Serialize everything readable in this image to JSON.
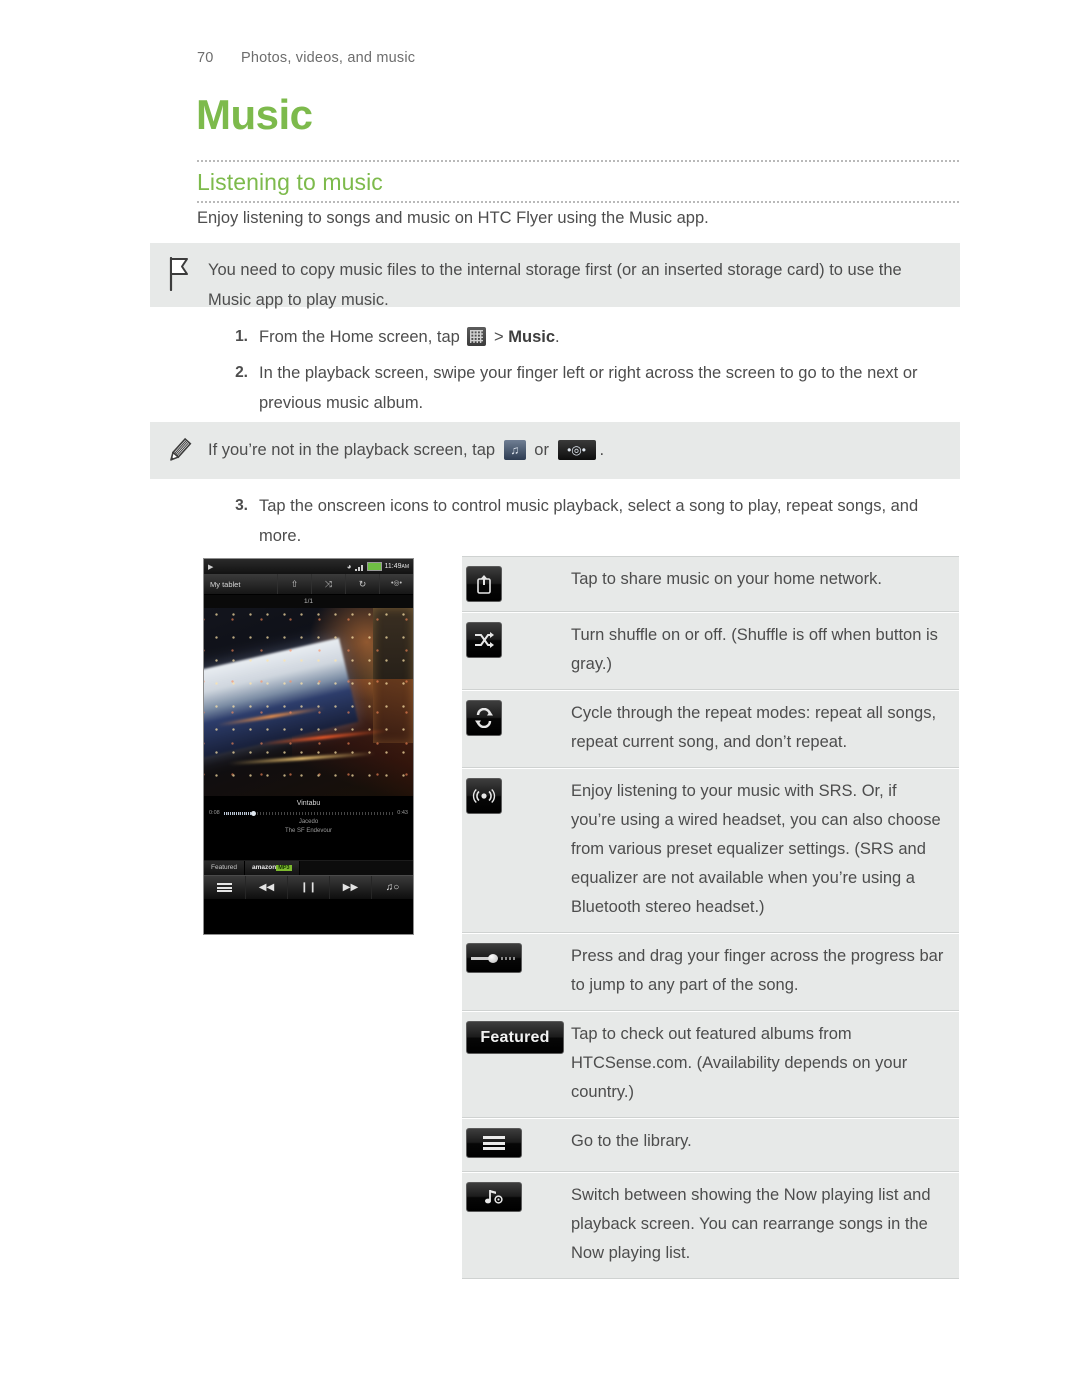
{
  "header": {
    "page_number": "70",
    "running_title": "Photos, videos, and music"
  },
  "chapter": {
    "title": "Music"
  },
  "section": {
    "heading": "Listening to music",
    "intro": "Enjoy listening to songs and music on HTC Flyer using the Music app."
  },
  "callouts": [
    {
      "icon": "flag-icon",
      "text": "You need to copy music files to the internal storage first (or an inserted storage card) to use the Music app to play music."
    },
    {
      "icon": "pencil-icon",
      "text_before": "If you’re not in the playback screen, tap",
      "text_middle": "or",
      "text_after": "."
    }
  ],
  "steps": [
    {
      "number": "1.",
      "text_before": "From the Home screen, tap",
      "text_after": ">",
      "bold_target": "Music",
      "trailing": "."
    },
    {
      "number": "2.",
      "text": "In the playback screen, swipe your finger left or right across the screen to go to the next or previous music album."
    },
    {
      "number": "3.",
      "text": "Tap the onscreen icons to control music playback, select a song to play, repeat songs, and more."
    }
  ],
  "device": {
    "status_clock": "11:49",
    "status_ampm": "AM",
    "toolbar_title": "My tablet",
    "toolbar_buttons": [
      "share-icon",
      "shuffle-icon",
      "repeat-icon",
      "srs-icon"
    ],
    "pager": "1/1",
    "now_title": "Vintabu",
    "elapsed": "0:08",
    "duration": "0:43",
    "artist": "Jacedo",
    "album": "The SF Endevour",
    "tab_featured": "Featured",
    "tab_amazon": "amazon",
    "tab_amazon_badge": "MP3",
    "controls": [
      "library-icon",
      "rewind-icon",
      "pause-icon",
      "forward-icon",
      "now-playing-icon"
    ]
  },
  "ref_table": {
    "rows": [
      {
        "icon": "share-icon",
        "description": "Tap to share music on your home network."
      },
      {
        "icon": "shuffle-icon",
        "description": "Turn shuffle on or off. (Shuffle is off when button is gray.)"
      },
      {
        "icon": "repeat-icon",
        "description": "Cycle through the repeat modes: repeat all songs, repeat current song, and don’t repeat."
      },
      {
        "icon": "srs-icon",
        "description": "Enjoy listening to your music with SRS. Or, if you’re using a wired headset, you can also choose from various preset equalizer settings. (SRS and equalizer are not available when you’re using a Bluetooth stereo headset.)"
      },
      {
        "icon": "progress-bar-icon",
        "description": "Press and drag your finger across the progress bar to jump to any part of the song."
      },
      {
        "icon": "featured-button-icon",
        "icon_label": "Featured",
        "description": "Tap to check out featured albums from HTCSense.com. (Availability depends on your country.)"
      },
      {
        "icon": "library-icon",
        "description": "Go to the library."
      },
      {
        "icon": "now-playing-icon",
        "description": "Switch between showing the Now playing list and playback screen. You can rearrange songs in the Now playing list."
      }
    ]
  },
  "colors": {
    "accent_green": "#7dba4c",
    "callout_bg": "#e7e9e8",
    "body_text": "#4d4d4d"
  }
}
